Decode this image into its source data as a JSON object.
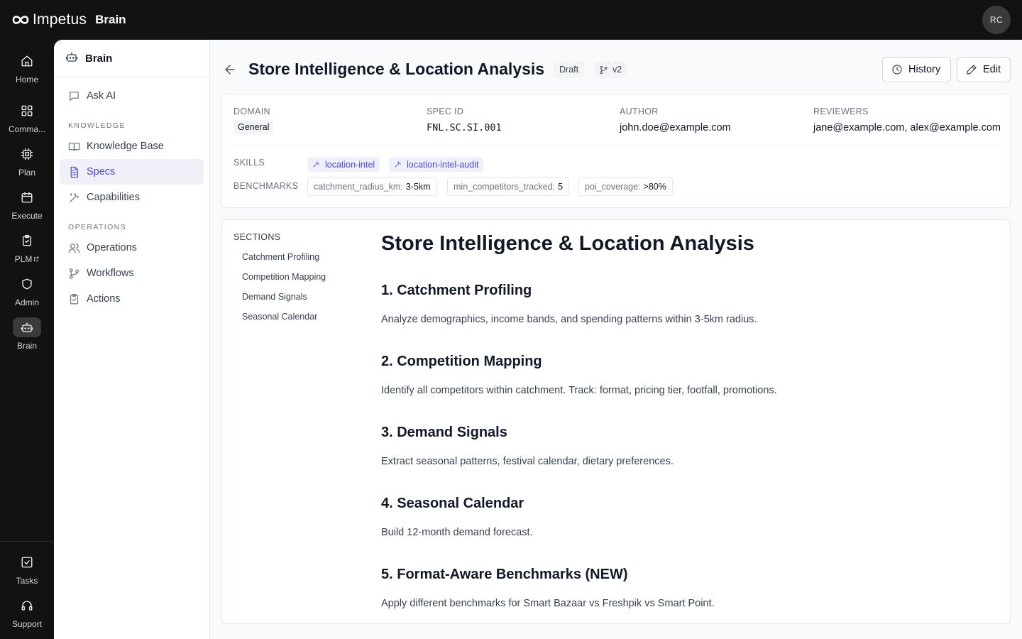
{
  "app": {
    "brand": "Impetus",
    "product": "Brain",
    "user_initials": "RC"
  },
  "rail": {
    "items": [
      {
        "label": "Home",
        "icon": "home-icon"
      },
      {
        "label": "Comma...",
        "icon": "grid-icon"
      },
      {
        "label": "Plan",
        "icon": "cpu-icon"
      },
      {
        "label": "Execute",
        "icon": "calendar-icon"
      },
      {
        "label": "PLM",
        "icon": "clipboard-icon"
      },
      {
        "label": "Admin",
        "icon": "shield-icon"
      },
      {
        "label": "Brain",
        "icon": "bot-icon"
      }
    ],
    "bottom": [
      {
        "label": "Tasks",
        "icon": "check-square-icon"
      },
      {
        "label": "Support",
        "icon": "headphones-icon"
      }
    ]
  },
  "sidebar": {
    "title": "Brain",
    "ask_ai": "Ask AI",
    "knowledge_heading": "KNOWLEDGE",
    "knowledge_items": [
      "Knowledge Base",
      "Specs",
      "Capabilities"
    ],
    "operations_heading": "OPERATIONS",
    "operations_items": [
      "Operations",
      "Workflows",
      "Actions"
    ],
    "active": "Specs"
  },
  "header": {
    "title": "Store Intelligence & Location Analysis",
    "status": "Draft",
    "version": "v2",
    "history_label": "History",
    "edit_label": "Edit"
  },
  "meta": {
    "domain_label": "DOMAIN",
    "domain_value": "General",
    "spec_id_label": "SPEC ID",
    "spec_id_value": "FNL.SC.SI.001",
    "author_label": "AUTHOR",
    "author_value": "john.doe@example.com",
    "reviewers_label": "REVIEWERS",
    "reviewers_value": "jane@example.com, alex@example.com",
    "skills_label": "SKILLS",
    "skills": [
      "location-intel",
      "location-intel-audit"
    ],
    "benchmarks_label": "BENCHMARKS",
    "benchmarks": [
      {
        "key": "catchment_radius_km:",
        "value": "3-5km"
      },
      {
        "key": "min_competitors_tracked:",
        "value": "5"
      },
      {
        "key": "poi_coverage:",
        "value": ">80%"
      }
    ]
  },
  "doc": {
    "sections_label": "SECTIONS",
    "toc": [
      "Catchment Profiling",
      "Competition Mapping",
      "Demand Signals",
      "Seasonal Calendar"
    ],
    "h1": "Store Intelligence & Location Analysis",
    "sections": [
      {
        "heading": "1. Catchment Profiling",
        "body": "Analyze demographics, income bands, and spending patterns within 3-5km radius."
      },
      {
        "heading": "2. Competition Mapping",
        "body": "Identify all competitors within catchment. Track: format, pricing tier, footfall, promotions."
      },
      {
        "heading": "3. Demand Signals",
        "body": "Extract seasonal patterns, festival calendar, dietary preferences."
      },
      {
        "heading": "4. Seasonal Calendar",
        "body": "Build 12-month demand forecast."
      },
      {
        "heading": "5. Format-Aware Benchmarks (NEW)",
        "body": "Apply different benchmarks for Smart Bazaar vs Freshpik vs Smart Point."
      }
    ]
  }
}
